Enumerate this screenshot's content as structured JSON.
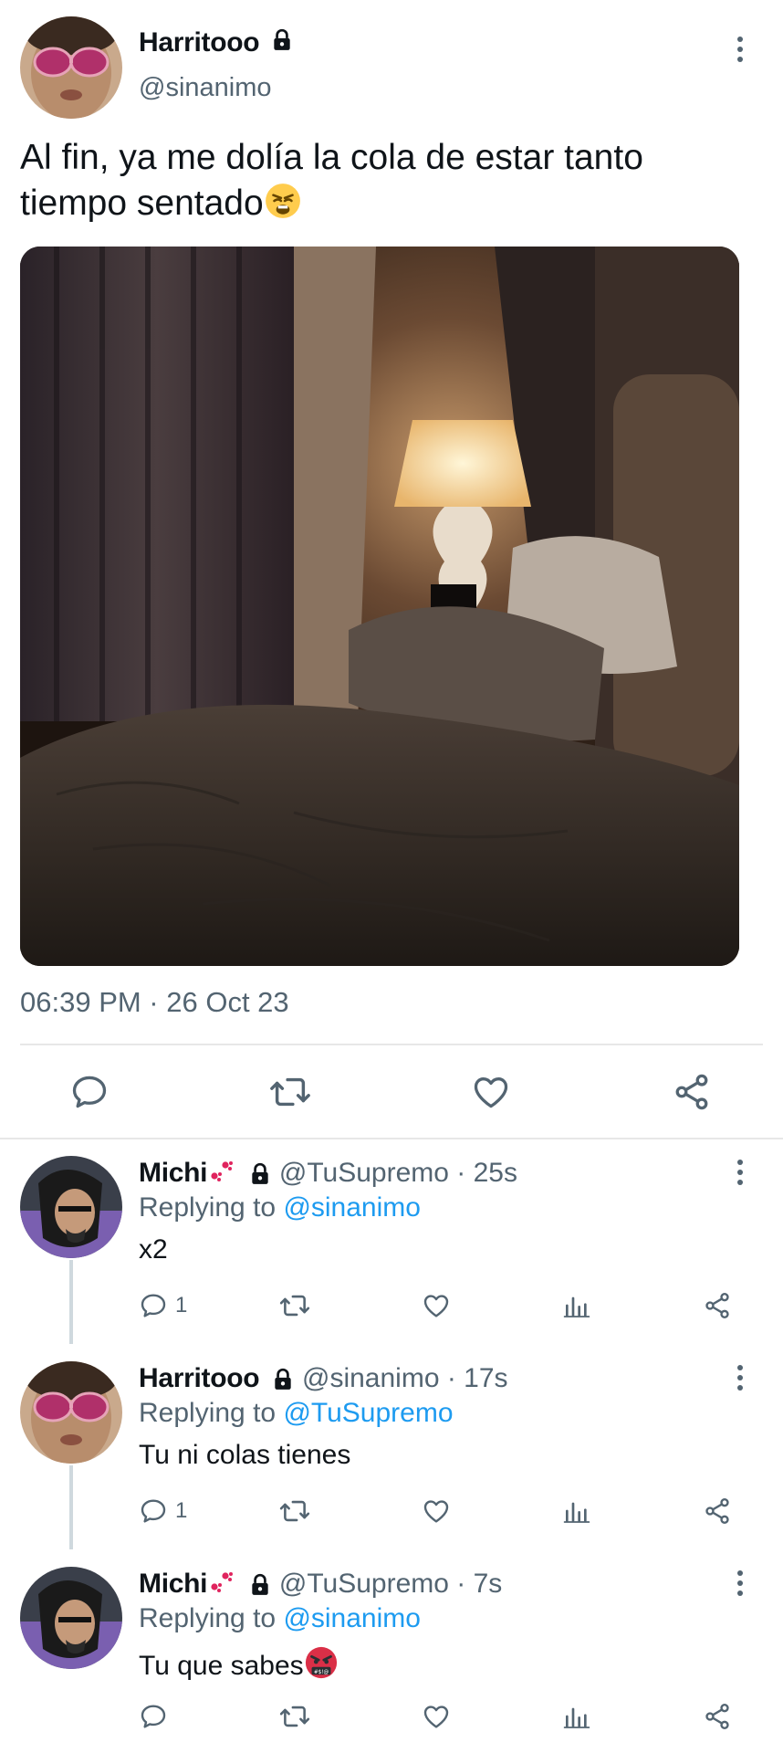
{
  "main_tweet": {
    "author_name": "Harritooo",
    "handle": "@sinanimo",
    "text": "Al fin, ya me dolía la cola de estar tanto tiempo sentado",
    "text_emoji": "weary-face",
    "timestamp": "06:39 PM · 26 Oct 23",
    "actions": [
      "reply-icon",
      "retweet-icon",
      "like-icon",
      "share-icon"
    ]
  },
  "replies": [
    {
      "author_name": "Michi",
      "handle": "@TuSupremo",
      "time": "· 25s",
      "replying_prefix": "Replying to ",
      "replying_to": "@sinanimo",
      "text": "x2",
      "reply_count": "1"
    },
    {
      "author_name": "Harritooo",
      "handle": "@sinanimo",
      "time": "· 17s",
      "replying_prefix": "Replying to ",
      "replying_to": "@TuSupremo",
      "text": "Tu ni colas tienes",
      "reply_count": "1"
    },
    {
      "author_name": "Michi",
      "handle": "@TuSupremo",
      "time": "· 7s",
      "replying_prefix": "Replying to ",
      "replying_to": "@sinanimo",
      "text": "Tu que sabes",
      "text_emoji": "cursing-face",
      "reply_count": ""
    }
  ],
  "colors": {
    "text": "#0f1419",
    "secondary": "#536471",
    "link": "#1d9bf0",
    "divider": "#e7e7e7"
  }
}
